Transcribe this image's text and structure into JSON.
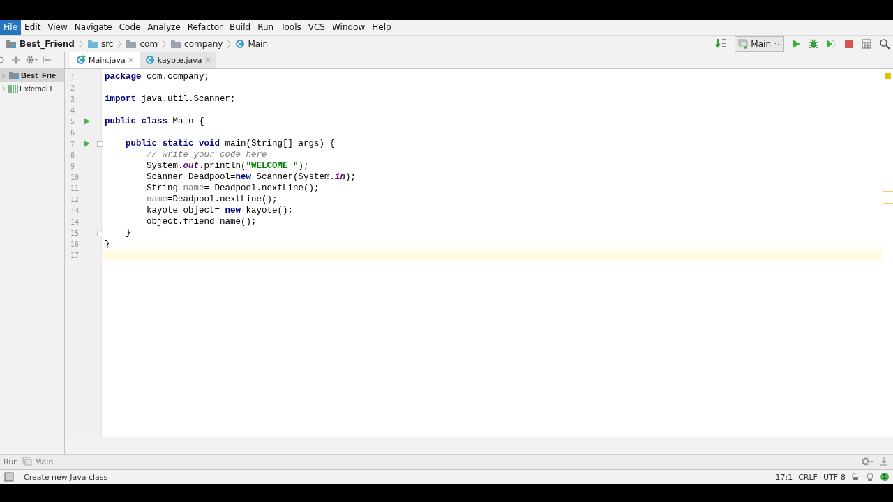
{
  "menu": [
    {
      "label": "File",
      "selected": true
    },
    {
      "label": "Edit",
      "selected": false
    },
    {
      "label": "View",
      "selected": false
    },
    {
      "label": "Navigate",
      "selected": false
    },
    {
      "label": "Code",
      "selected": false
    },
    {
      "label": "Analyze",
      "selected": false
    },
    {
      "label": "Refactor",
      "selected": false
    },
    {
      "label": "Build",
      "selected": false
    },
    {
      "label": "Run",
      "selected": false
    },
    {
      "label": "Tools",
      "selected": false
    },
    {
      "label": "VCS",
      "selected": false
    },
    {
      "label": "Window",
      "selected": false
    },
    {
      "label": "Help",
      "selected": false
    }
  ],
  "breadcrumbs": [
    {
      "label": "Best_Friend",
      "kind": "project"
    },
    {
      "label": "src",
      "kind": "source"
    },
    {
      "label": "com",
      "kind": "folder"
    },
    {
      "label": "company",
      "kind": "folder"
    },
    {
      "label": "Main",
      "kind": "class"
    }
  ],
  "run_config": "Main",
  "project_tree": [
    {
      "label": "Best_Frie",
      "kind": "project",
      "selected": true
    },
    {
      "label": "External L",
      "kind": "library",
      "selected": false
    }
  ],
  "tabs": [
    {
      "label": "Main.java",
      "selected": true
    },
    {
      "label": "kayote.java",
      "selected": false
    }
  ],
  "editor": {
    "lines": [
      {
        "number": "1",
        "current": false,
        "tokens": [
          {
            "kind": "kw",
            "text": "package"
          },
          {
            "kind": "plain",
            "text": " com.company;"
          }
        ]
      },
      {
        "number": "2",
        "current": false
      },
      {
        "number": "3",
        "current": false,
        "tokens": [
          {
            "kind": "kw",
            "text": "import"
          },
          {
            "kind": "plain",
            "text": " java.util.Scanner;"
          }
        ]
      },
      {
        "number": "4",
        "current": false
      },
      {
        "number": "5",
        "current": false,
        "run": true,
        "tokens": [
          {
            "kind": "kw",
            "text": "public class"
          },
          {
            "kind": "plain",
            "text": " Main {"
          }
        ]
      },
      {
        "number": "6",
        "current": false
      },
      {
        "number": "7",
        "current": false,
        "run": true,
        "fold_start": true,
        "tokens": [
          {
            "kind": "kw",
            "text": "    public static void"
          },
          {
            "kind": "plain",
            "text": " main(String[] args) {"
          }
        ]
      },
      {
        "number": "8",
        "current": false,
        "tokens": [
          {
            "kind": "comment",
            "text": "        // write your code here"
          }
        ]
      },
      {
        "number": "9",
        "current": false,
        "tokens": [
          {
            "kind": "plain",
            "text": "        System."
          },
          {
            "kind": "static",
            "text": "out"
          },
          {
            "kind": "plain",
            "text": ".println("
          },
          {
            "kind": "str",
            "text": "\"WELCOME \""
          },
          {
            "kind": "plain",
            "text": ");"
          }
        ]
      },
      {
        "number": "10",
        "current": false,
        "tokens": [
          {
            "kind": "plain",
            "text": "        Scanner Deadpool="
          },
          {
            "kind": "kw",
            "text": "new"
          },
          {
            "kind": "plain",
            "text": " Scanner(System."
          },
          {
            "kind": "static",
            "text": "in"
          },
          {
            "kind": "plain",
            "text": ");"
          }
        ]
      },
      {
        "number": "11",
        "current": false,
        "warning": true,
        "tokens": [
          {
            "kind": "plain",
            "text": "        String "
          },
          {
            "kind": "unused",
            "text": "name"
          },
          {
            "kind": "plain",
            "text": "= Deadpool.nextLine();"
          }
        ]
      },
      {
        "number": "12",
        "current": false,
        "warning": true,
        "tokens": [
          {
            "kind": "unused",
            "text": "        name"
          },
          {
            "kind": "plain",
            "text": "=Deadpool.nextLine();"
          }
        ]
      },
      {
        "number": "13",
        "current": false,
        "tokens": [
          {
            "kind": "plain",
            "text": "        kayote object= "
          },
          {
            "kind": "kw",
            "text": "new"
          },
          {
            "kind": "plain",
            "text": " kayote();"
          }
        ]
      },
      {
        "number": "14",
        "current": false,
        "tokens": [
          {
            "kind": "plain",
            "text": "        object.friend_name();"
          }
        ]
      },
      {
        "number": "15",
        "current": false,
        "fold_end": true,
        "tokens": [
          {
            "kind": "plain",
            "text": "    }"
          }
        ]
      },
      {
        "number": "16",
        "current": false,
        "tokens": [
          {
            "kind": "plain",
            "text": "}"
          }
        ]
      },
      {
        "number": "17",
        "current": true
      }
    ]
  },
  "tool_window": {
    "label": "Run",
    "tab": "Main"
  },
  "status_bar": {
    "message": "Create new Java class",
    "position": "17:1",
    "line_separator": "CRLF",
    "encoding": "UTF-8",
    "notifications": "1"
  }
}
